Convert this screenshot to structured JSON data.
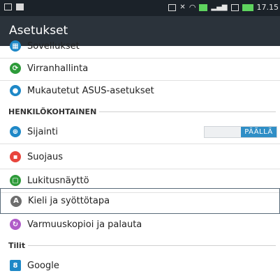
{
  "statusbar": {
    "time": "17.15"
  },
  "appbar": {
    "title": "Asetukset"
  },
  "items": {
    "apps": {
      "label": "Sovellukset",
      "color": "#1e88c7"
    },
    "power": {
      "label": "Virranhallinta",
      "color": "#2e9b3a"
    },
    "asus": {
      "label": "Mukautetut ASUS-asetukset",
      "color": "#1e88c7"
    },
    "location": {
      "label": "Sijainti",
      "color": "#1e88c7"
    },
    "security": {
      "label": "Suojaus",
      "color": "#e8453c"
    },
    "lockscreen": {
      "label": "Lukitusnäyttö",
      "color": "#2e9b3a"
    },
    "language": {
      "label": "Kieli ja syöttötapa",
      "color": "#6d6d6d"
    },
    "backup": {
      "label": "Varmuuskopioi ja palauta",
      "color": "#b05cc8"
    },
    "google": {
      "label": "Google",
      "color": "#1e88c7"
    }
  },
  "sections": {
    "personal": "HENKILÖKOHTAINEN",
    "accounts": "Tilit"
  },
  "location_toggle": {
    "state_label": "PÄÄLLÄ",
    "on": true
  }
}
